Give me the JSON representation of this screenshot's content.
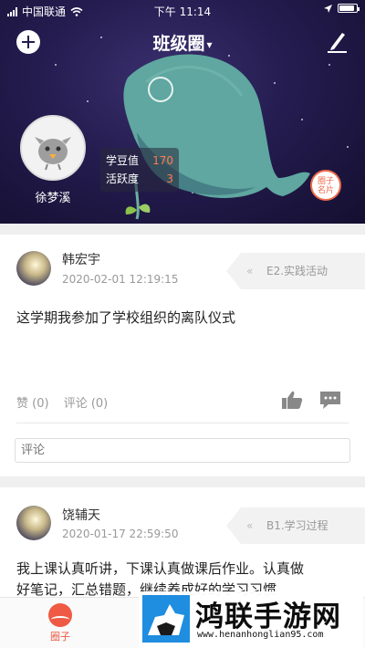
{
  "status_bar": {
    "carrier": "中国联通",
    "time": "下午 11:14"
  },
  "header": {
    "title": "班级圈",
    "title_caret": "▾",
    "user": {
      "name": "徐梦溪"
    },
    "stats": [
      {
        "label": "学豆值",
        "value": "170"
      },
      {
        "label": "活跃度",
        "value": "3"
      }
    ],
    "card_badge_line1": "圈子",
    "card_badge_line2": "名片",
    "icons": {
      "add": "plus-circle-icon",
      "edit": "pen-icon",
      "camera": "camera-ring-icon"
    }
  },
  "posts": [
    {
      "author": "韩宏宇",
      "time": "2020-02-01 12:19:15",
      "tag": "E2.实践活动",
      "text": "这学期我参加了学校组织的离队仪式",
      "like_label": "赞 (0)",
      "comment_label": "评论 (0)",
      "comment_placeholder": "评论"
    },
    {
      "author": "饶辅天",
      "time": "2020-01-17 22:59:50",
      "tag": "B1.学习过程",
      "text_line1": "我上课认真听讲，下课认真做课后作业。认真做",
      "text_line2": "好笔记，汇总错题，继续养成好的学习习惯"
    }
  ],
  "tabbar": {
    "items": [
      {
        "label": "圈子",
        "icon": "circle-wave-icon"
      }
    ]
  },
  "watermark": {
    "title": "鸿联手游网",
    "url": "www.henanhonglian95.com"
  },
  "colors": {
    "accent": "#ee5a44",
    "header_bg": "#241c4f",
    "stat_value": "#ff7b54"
  }
}
